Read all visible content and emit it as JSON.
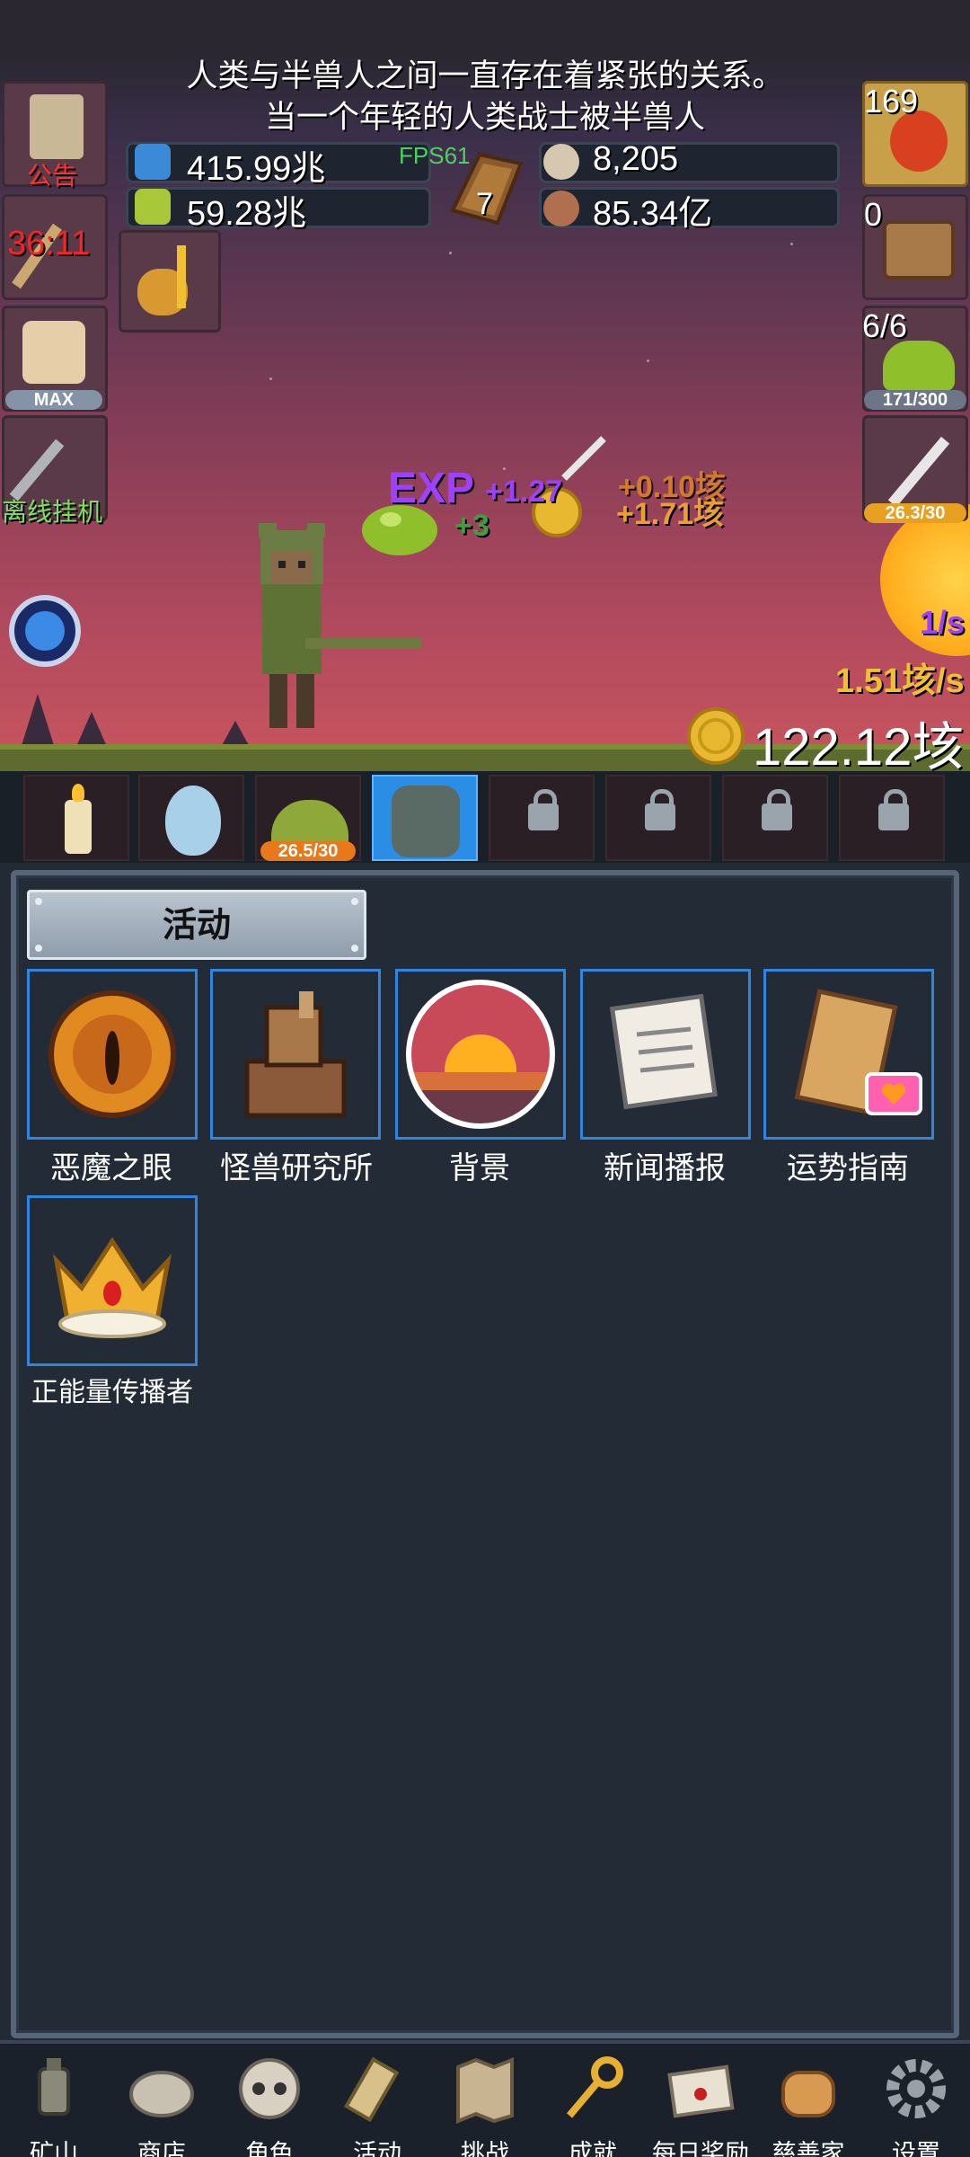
{
  "announcement": {
    "line1": "人类与半兽人之间一直存在着紧张的关系。",
    "line2": "当一个年轻的人类战士被半兽人"
  },
  "resources": {
    "blue_potion": "415.99兆",
    "green_potion": "59.28兆",
    "book_count": "7",
    "shell": "8,205",
    "meat": "85.34亿",
    "fps": "FPS61"
  },
  "left_buttons": {
    "notice_label": "公告",
    "timer": "36:11",
    "beer_badge": "MAX",
    "offline_label": "离线挂机"
  },
  "right_buttons": {
    "potion_count": "169",
    "chest_count": "0",
    "slime_count": "6/6",
    "slime_progress": "171/300",
    "sword_progress": "26.3/30"
  },
  "floating": {
    "exp": "EXP",
    "exp_gain": "+1.27",
    "slime_gain": "+3",
    "coin_gain_1": "+0.10垓",
    "coin_gain_2": "+1.71垓",
    "per_sec_1": "1/s",
    "per_sec_2": "1.51垓/s",
    "gold_total": "122.12垓"
  },
  "units": {
    "slime_progress": "26.5/30"
  },
  "panel": {
    "tab_title": "活动",
    "activities": [
      {
        "label": "恶魔之眼",
        "icon": "demon-eye-icon"
      },
      {
        "label": "怪兽研究所",
        "icon": "monster-lab-icon"
      },
      {
        "label": "背景",
        "icon": "sunset-background-icon"
      },
      {
        "label": "新闻播报",
        "icon": "newspaper-icon"
      },
      {
        "label": "运势指南",
        "icon": "fortune-guide-icon"
      },
      {
        "label": "正能量传播者",
        "icon": "crown-icon"
      }
    ]
  },
  "nav": [
    {
      "label": "矿山",
      "icon": "lantern-icon"
    },
    {
      "label": "商店",
      "icon": "shop-stone-icon"
    },
    {
      "label": "角色",
      "icon": "skull-icon"
    },
    {
      "label": "活动",
      "icon": "scroll-icon"
    },
    {
      "label": "挑战",
      "icon": "map-icon"
    },
    {
      "label": "成就",
      "icon": "key-icon"
    },
    {
      "label": "每日奖励",
      "icon": "envelope-icon"
    },
    {
      "label": "慈善家",
      "icon": "bread-icon"
    },
    {
      "label": "设置",
      "icon": "gear-icon"
    }
  ],
  "colors": {
    "accent_blue": "#2f86e0",
    "panel_bg": "#232b37",
    "fps_green": "#4fcf63",
    "exp_purple": "#a040ff",
    "gold": "#f0c030"
  }
}
